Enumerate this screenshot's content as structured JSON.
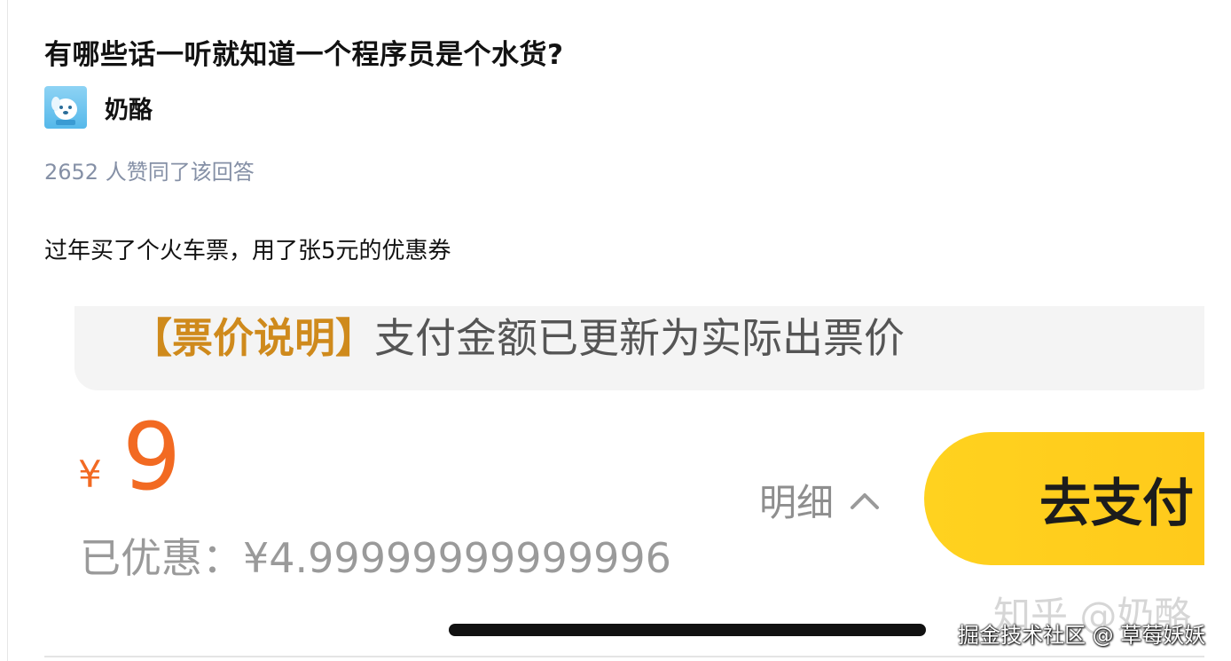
{
  "question": {
    "title": "有哪些话一听就知道一个程序员是个水货?"
  },
  "author": {
    "name": "奶酪",
    "avatar_icon": "dog-avatar-icon"
  },
  "answer": {
    "vote_text": "2652 人赞同了该回答",
    "body": "过年买了个火车票，用了张5元的优惠券"
  },
  "screenshot": {
    "notice_bracket": "【票价说明】",
    "notice_text": "支付金额已更新为实际出票价",
    "currency": "¥",
    "price": "9",
    "discount": "已优惠：¥4.99999999999996",
    "detail_label": "明细",
    "detail_icon": "chevron-up-icon",
    "pay_label": "去支付",
    "watermark": "知乎 @奶酪"
  },
  "site_watermark": "掘金技术社区 @ 草莓妖妖",
  "colors": {
    "price": "#f26a22",
    "notice_bracket": "#cf8a1c",
    "pay_button": "#ffd21f",
    "vote": "#8590a6"
  }
}
